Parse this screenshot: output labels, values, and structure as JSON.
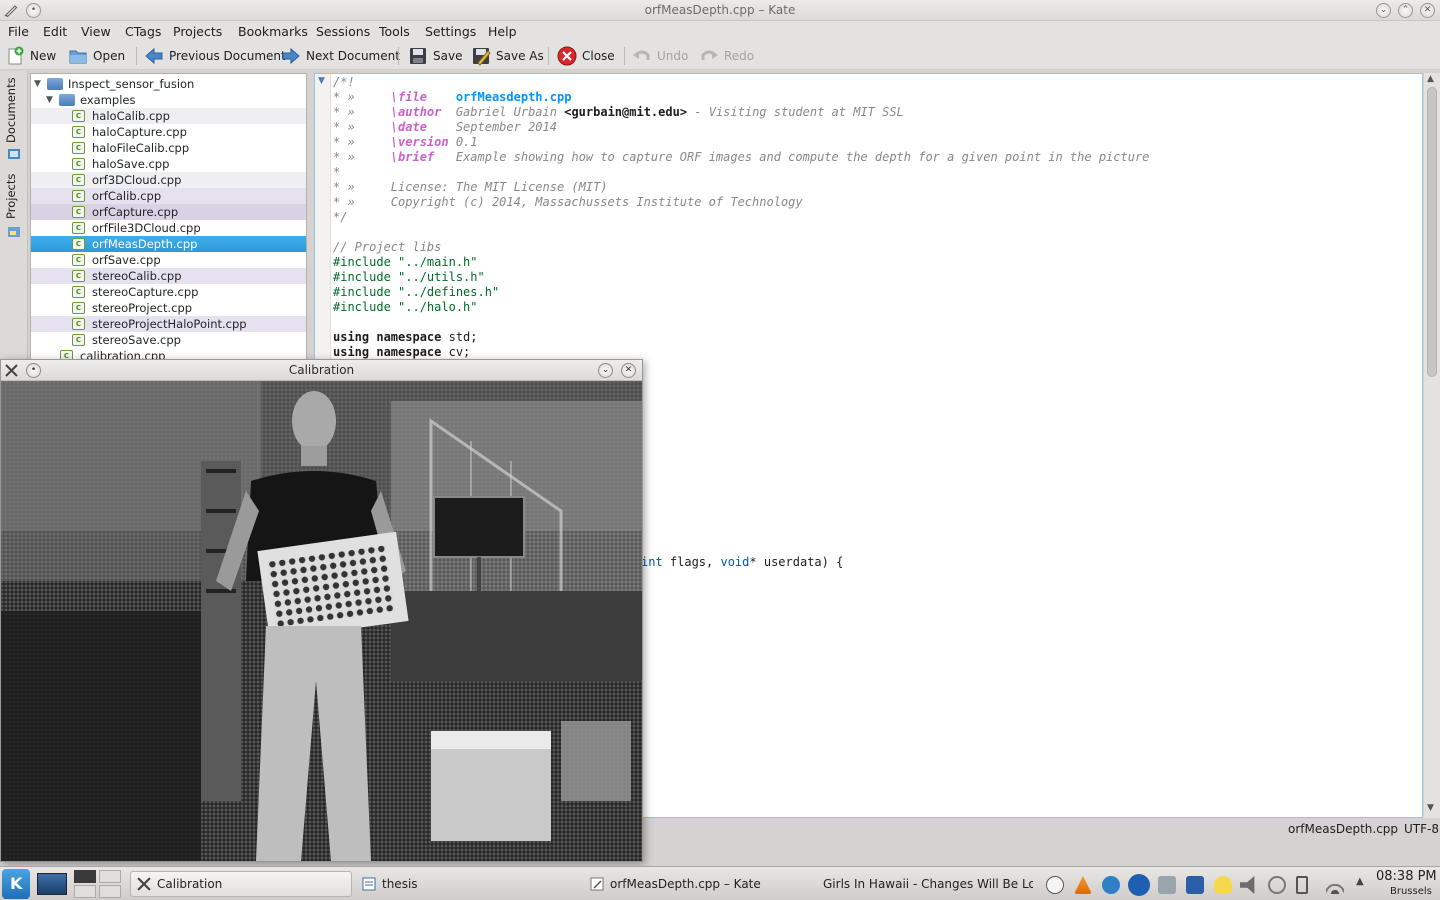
{
  "window": {
    "title": "orfMeasDepth.cpp – Kate"
  },
  "menu": [
    "File",
    "Edit",
    "View",
    "CTags",
    "Projects",
    "Bookmarks",
    "Sessions",
    "Tools",
    "Settings",
    "Help"
  ],
  "toolbar": {
    "new": "New",
    "open": "Open",
    "prev": "Previous Document",
    "next": "Next Document",
    "save": "Save",
    "save_as": "Save As",
    "close": "Close",
    "undo": "Undo",
    "redo": "Redo"
  },
  "sidetabs": {
    "documents": "Documents",
    "projects": "Projects"
  },
  "tree": {
    "root": "Inspect_sensor_fusion",
    "folder": "examples",
    "files": [
      "haloCalib.cpp",
      "haloCapture.cpp",
      "haloFileCalib.cpp",
      "haloSave.cpp",
      "orf3DCloud.cpp",
      "orfCalib.cpp",
      "orfCapture.cpp",
      "orfFile3DCloud.cpp",
      "orfMeasDepth.cpp",
      "orfSave.cpp",
      "stereoCalib.cpp",
      "stereoCapture.cpp",
      "stereoProject.cpp",
      "stereoProjectHaloPoint.cpp",
      "stereoSave.cpp"
    ],
    "next_item": "calibration.cpp",
    "selected": "orfMeasDepth.cpp"
  },
  "code": {
    "l1": "/*!",
    "file_tag": "\\file",
    "file_val": "orfMeasdepth.cpp",
    "author_tag": "\\author",
    "author_val": "Gabriel Urbain",
    "author_mail": "<gurbain@mit.edu>",
    "author_rest": " - Visiting student at MIT SSL",
    "date_tag": "\\date",
    "date_val": "September 2014",
    "version_tag": "\\version",
    "version_val": "0.1",
    "brief_tag": "\\brief",
    "brief_val": "Example showing how to capture ORF images and compute the depth for a given point in the picture",
    "license": "License: The MIT License (MIT)",
    "copyright": "Copyright (c) 2014, Massachussets Institute of Technology",
    "close": "*/",
    "libs_comment": "// Project libs",
    "inc1": "#include \"../main.h\"",
    "inc2": "#include \"../utils.h\"",
    "inc3": "#include \"../defines.h\"",
    "inc4": "#include \"../halo.h\"",
    "using_kw": "using namespace",
    "using1": " std;",
    "using2": " cv;",
    "partial_int": "int",
    "partial_mid": " flags, ",
    "partial_void": "void",
    "partial_end": "* userdata) {"
  },
  "status": {
    "file": "orfMeasDepth.cpp",
    "encoding": "UTF-8"
  },
  "calibration": {
    "title": "Calibration"
  },
  "taskbar": {
    "tasks": [
      "Calibration",
      "thesis",
      "orfMeasDepth.cpp – Kate",
      "Girls In Hawaii - Changes Will Be Lo"
    ],
    "clock": "08:38 PM",
    "location": "Brussels"
  },
  "colors": {
    "accent": "#3daee9",
    "editor_border": "#8ec7ea"
  }
}
